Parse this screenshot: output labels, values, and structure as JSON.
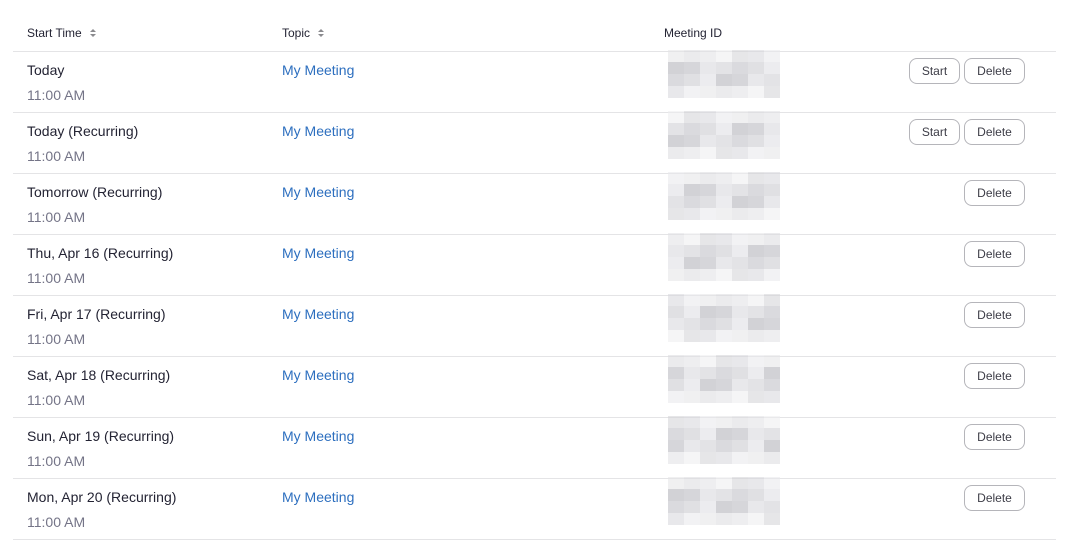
{
  "table": {
    "columns": {
      "start_time": "Start Time",
      "topic": "Topic",
      "meeting_id": "Meeting ID"
    },
    "rows": [
      {
        "day": "Today",
        "time": "11:00 AM",
        "topic": "My Meeting",
        "has_start": true
      },
      {
        "day": "Today (Recurring)",
        "time": "11:00 AM",
        "topic": "My Meeting",
        "has_start": true
      },
      {
        "day": "Tomorrow (Recurring)",
        "time": "11:00 AM",
        "topic": "My Meeting",
        "has_start": false
      },
      {
        "day": "Thu, Apr 16 (Recurring)",
        "time": "11:00 AM",
        "topic": "My Meeting",
        "has_start": false
      },
      {
        "day": "Fri, Apr 17 (Recurring)",
        "time": "11:00 AM",
        "topic": "My Meeting",
        "has_start": false
      },
      {
        "day": "Sat, Apr 18 (Recurring)",
        "time": "11:00 AM",
        "topic": "My Meeting",
        "has_start": false
      },
      {
        "day": "Sun, Apr 19 (Recurring)",
        "time": "11:00 AM",
        "topic": "My Meeting",
        "has_start": false
      },
      {
        "day": "Mon, Apr 20 (Recurring)",
        "time": "11:00 AM",
        "topic": "My Meeting",
        "has_start": false
      }
    ]
  },
  "actions": {
    "start_label": "Start",
    "delete_label": "Delete"
  },
  "icons": {
    "sort": "sort-icon",
    "meeting_id": "pixelated-redaction"
  },
  "colors": {
    "link": "#2d6fbf",
    "text": "#232333",
    "muted": "#747487",
    "border": "#e4e4e6"
  }
}
